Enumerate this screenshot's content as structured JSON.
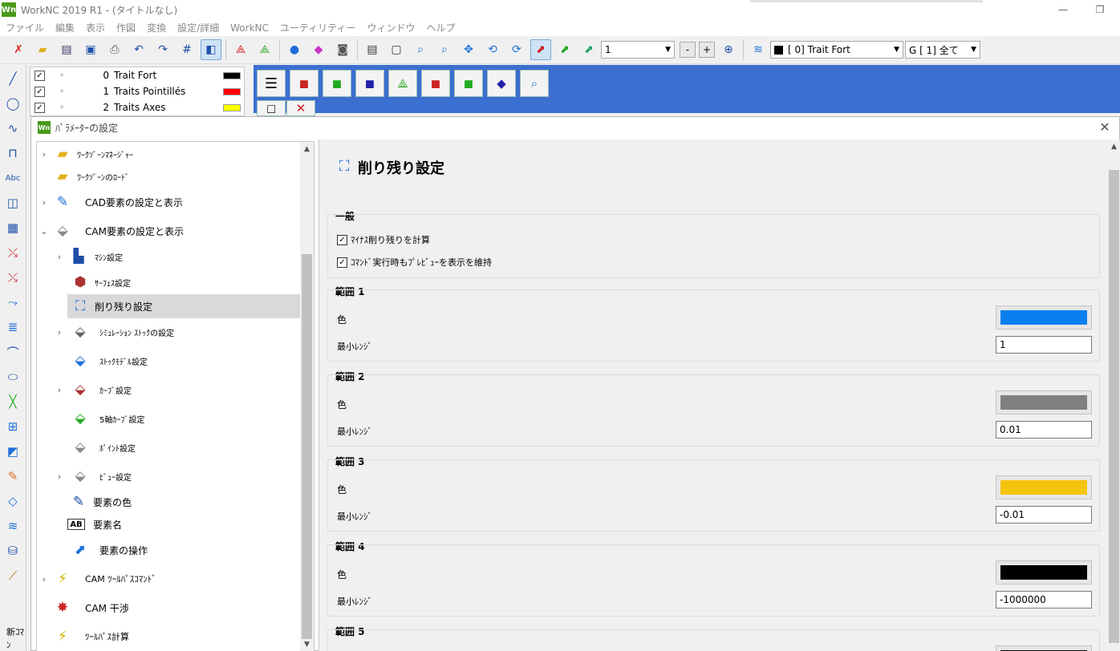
{
  "window": {
    "logo": "Wn",
    "title": "WorkNC 2019 R1 - (タイトルなし)"
  },
  "menu": [
    "ファイル",
    "編集",
    "表示",
    "作図",
    "変換",
    "設定/詳細",
    "WorkNC",
    "ユーティリティー",
    "ウィンドウ",
    "ヘルプ"
  ],
  "toolbar": {
    "zoom_value": "1",
    "layer_combo": "[   0]  Trait Fort",
    "group_combo": "G [   1] 全て",
    "minus": "-",
    "plus": "+"
  },
  "layers": [
    {
      "num": "0",
      "name": "Trait Fort",
      "color": "#000000"
    },
    {
      "num": "1",
      "name": "Traits Pointillés",
      "color": "#ff0000"
    },
    {
      "num": "2",
      "name": "Traits Axes",
      "color": "#ffff00"
    }
  ],
  "left_toolbar_bottom": "新ｺﾏﾝ",
  "dialog": {
    "logo": "Wn",
    "title": "ﾊﾟﾗﾒｰﾀｰの設定",
    "tree": [
      {
        "label": "ﾜｰｸｿﾞｰﾝﾏﾈｰｼﾞｬｰ",
        "icon": "folder-icon"
      },
      {
        "label": "ﾜｰｸｿﾞｰﾝのﾛｰﾄﾞ",
        "icon": "folder-open-icon"
      },
      {
        "label": "CAD要素の設定と表示",
        "icon": "cad-brush-icon"
      },
      {
        "label": "CAM要素の設定と表示",
        "icon": "cam-tool-icon"
      },
      {
        "label": "ﾏｼﾝ設定",
        "icon": "machine-icon"
      },
      {
        "label": "ｻｰﾌｪｽ設定",
        "icon": "surface-icon"
      },
      {
        "label": "削り残り設定",
        "icon": "rest-material-icon"
      },
      {
        "label": "ｼﾐｭﾚｰｼｮﾝ ｽﾄｯｸの設定",
        "icon": "simulation-stock-icon"
      },
      {
        "label": "ｽﾄｯｸﾓﾃﾞﾙ設定",
        "icon": "stock-model-icon"
      },
      {
        "label": "ｶｰﾌﾞ設定",
        "icon": "curve-icon"
      },
      {
        "label": "5軸ｶｰﾌﾞ設定",
        "icon": "five-axis-curve-icon"
      },
      {
        "label": "ﾎﾟｲﾝﾄ設定",
        "icon": "point-icon"
      },
      {
        "label": "ﾋﾞｭｰ設定",
        "icon": "view-icon"
      },
      {
        "label": "要素の色",
        "icon": "element-color-icon"
      },
      {
        "label": "要素名",
        "icon": "element-name-icon"
      },
      {
        "label": "要素の操作",
        "icon": "element-operation-icon"
      },
      {
        "label": "CAM ﾂｰﾙﾊﾟｽｺﾏﾝﾄﾞ",
        "icon": "toolpath-command-icon"
      },
      {
        "label": "CAM 干渉",
        "icon": "collision-icon"
      },
      {
        "label": "ﾂｰﾙﾊﾟｽ計算",
        "icon": "toolpath-calc-icon"
      }
    ],
    "panel": {
      "title": "削り残り設定",
      "general": {
        "header": "一般",
        "check1": "ﾏｲﾅｽ削り残りを計算",
        "check2": "ｺﾏﾝﾄﾞ実行時もﾌﾟﾚﾋﾞｭｰを表示を維持"
      },
      "ranges": [
        {
          "header": "範囲 1",
          "color_label": "色",
          "min_label": "最小ﾚﾝｼﾞ",
          "color": "#0a7ff0",
          "value": "1"
        },
        {
          "header": "範囲 2",
          "color_label": "色",
          "min_label": "最小ﾚﾝｼﾞ",
          "color": "#808080",
          "value": "0.01"
        },
        {
          "header": "範囲 3",
          "color_label": "色",
          "min_label": "最小ﾚﾝｼﾞ",
          "color": "#f5c40c",
          "value": "-0.01"
        },
        {
          "header": "範囲 4",
          "color_label": "色",
          "min_label": "最小ﾚﾝｼﾞ",
          "color": "#000000",
          "value": "-1000000"
        },
        {
          "header": "範囲 5",
          "color": "#000000"
        }
      ]
    }
  }
}
